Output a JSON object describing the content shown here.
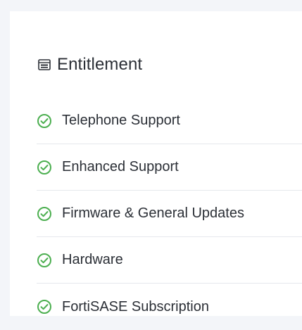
{
  "card": {
    "title": "Entitlement",
    "title_icon": "license-card-icon",
    "items": [
      {
        "label": "Telephone Support",
        "status_icon": "check-circle-icon",
        "status": "active"
      },
      {
        "label": "Enhanced Support",
        "status_icon": "check-circle-icon",
        "status": "active"
      },
      {
        "label": "Firmware & General Updates",
        "status_icon": "check-circle-icon",
        "status": "active"
      },
      {
        "label": "Hardware",
        "status_icon": "check-circle-icon",
        "status": "active"
      },
      {
        "label": "FortiSASE Subscription",
        "status_icon": "check-circle-icon",
        "status": "active"
      }
    ]
  },
  "colors": {
    "background": "#f3f5f9",
    "card": "#ffffff",
    "text": "#2b2f36",
    "check": "#4caf50",
    "divider": "#e6e8ec"
  }
}
